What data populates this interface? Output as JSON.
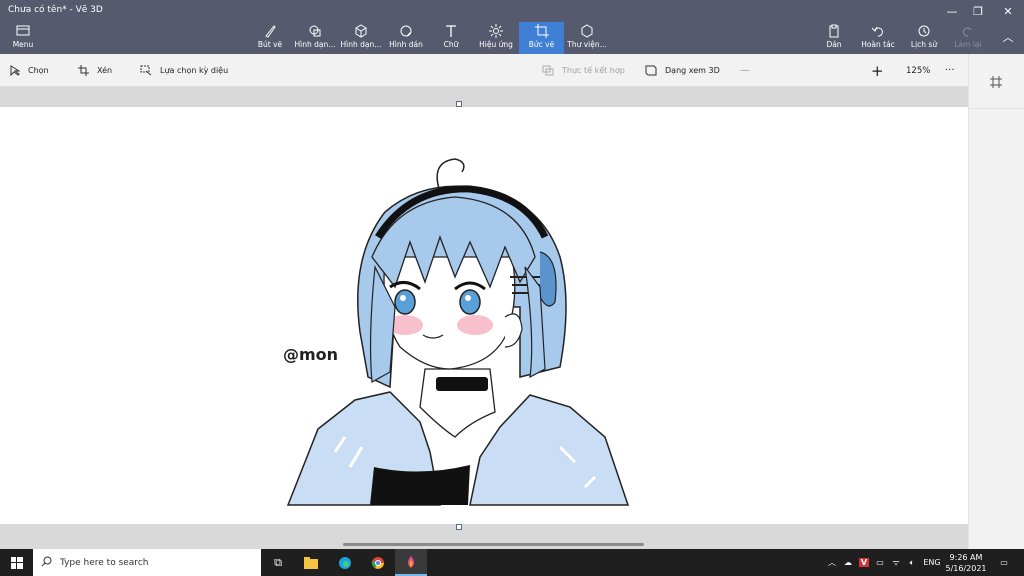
{
  "app": {
    "title": "Chưa có tên* - Vẽ 3D",
    "menu_label": "Menu"
  },
  "ribbon": {
    "items": [
      {
        "label": "Bút vẽ",
        "icon": "brush-icon"
      },
      {
        "label": "Hình dạn...",
        "icon": "2d-shapes-icon"
      },
      {
        "label": "Hình dạn...",
        "icon": "3d-shapes-icon"
      },
      {
        "label": "Hình dán",
        "icon": "stickers-icon"
      },
      {
        "label": "Chữ",
        "icon": "text-icon"
      },
      {
        "label": "Hiệu ứng",
        "icon": "effects-icon"
      },
      {
        "label": "Bức vẽ",
        "icon": "canvas-icon"
      },
      {
        "label": "Thư viện...",
        "icon": "library-icon"
      }
    ],
    "right": [
      {
        "label": "Dán",
        "icon": "paste-icon"
      },
      {
        "label": "Hoàn tác",
        "icon": "undo-icon"
      },
      {
        "label": "Lịch sử",
        "icon": "history-icon"
      },
      {
        "label": "Làm lại",
        "icon": "redo-icon"
      }
    ],
    "active": "Bức vẽ"
  },
  "toolbar": {
    "select_label": "Chọn",
    "crop_label": "Xén",
    "magic_select_label": "Lựa chọn kỳ diệu",
    "mixed_reality_label": "Thực tế kết hợp",
    "view3d_label": "Dạng xem 3D",
    "zoom_label": "125%",
    "zoom_level": 0.5,
    "more_label": "···"
  },
  "canvas": {
    "watermark": "@mon"
  },
  "taskbar": {
    "search_placeholder": "Type here to search",
    "language": "ENG",
    "time": "9:26 AM",
    "date": "5/16/2021"
  },
  "colors": {
    "ribbon_bg": "#565a6e",
    "accent": "#3f7fd6",
    "hair": "#a7c9ec"
  }
}
